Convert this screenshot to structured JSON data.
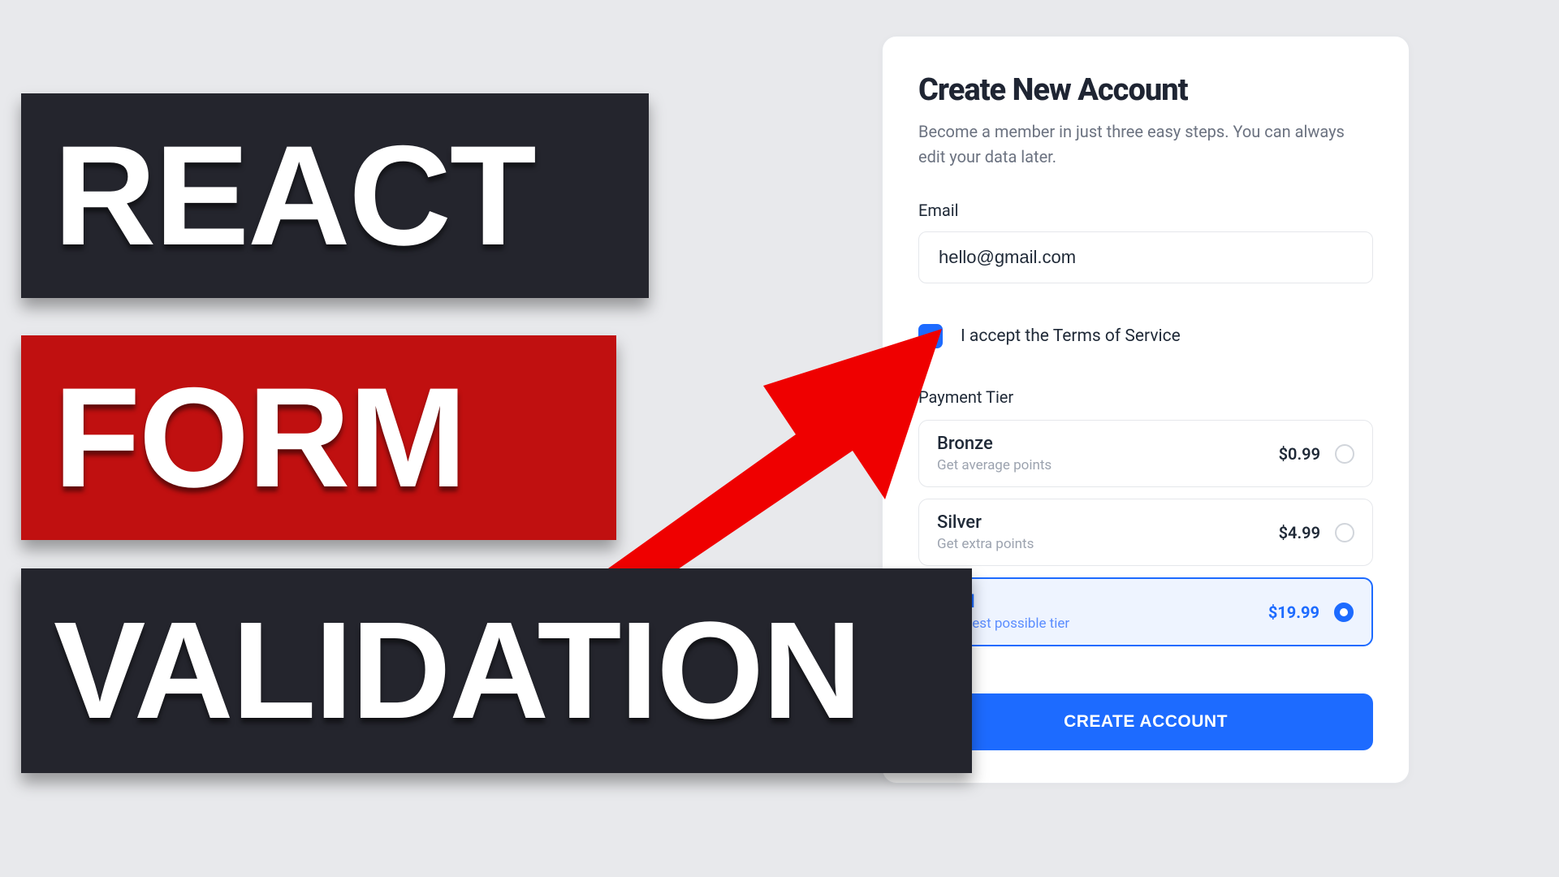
{
  "headline": {
    "word1": "REACT",
    "word2": "FORM",
    "word3": "VALIDATION"
  },
  "form": {
    "title": "Create New Account",
    "description": "Become a member in just three easy steps. You can always edit your data later.",
    "email_label": "Email",
    "email_value": "hello@gmail.com",
    "tos_label": "I accept the Terms of Service",
    "tos_checked": true,
    "tier_label": "Payment Tier",
    "tiers": [
      {
        "name": "Bronze",
        "sub": "Get average points",
        "price": "$0.99",
        "selected": false
      },
      {
        "name": "Silver",
        "sub": "Get extra points",
        "price": "$4.99",
        "selected": false
      },
      {
        "name": "Gold",
        "sub": "The best possible tier",
        "price": "$19.99",
        "selected": true
      }
    ],
    "submit": "CREATE ACCOUNT"
  },
  "colors": {
    "accent": "#1d6bff",
    "danger": "#c01010",
    "dark": "#24252d"
  }
}
